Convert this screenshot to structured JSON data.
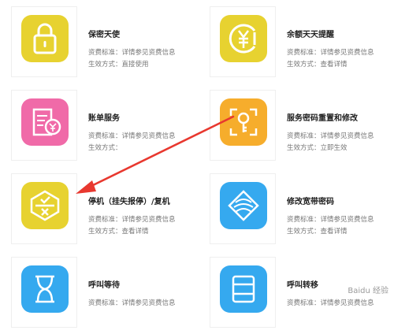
{
  "services": [
    {
      "title": "保密天使",
      "line1": "资费标准：详情参见资费信息",
      "line2": "生效方式：直接使用",
      "icon": "lock-icon",
      "color": "#e7d230"
    },
    {
      "title": "余额天天提醒",
      "line1": "资费标准：详情参见资费信息",
      "line2": "生效方式：查看详情",
      "icon": "yen-coin-icon",
      "color": "#e7d230"
    },
    {
      "title": "账单服务",
      "line1": "资费标准：详情参见资费信息",
      "line2": "生效方式：",
      "icon": "bill-icon",
      "color": "#f06aa8"
    },
    {
      "title": "服务密码重置和修改",
      "line1": "资费标准：详情参见资费信息",
      "line2": "生效方式：立即生效",
      "icon": "key-icon",
      "color": "#f6ad2c"
    },
    {
      "title": "停机（挂失报停）/复机",
      "line1": "资费标准：详情参见资费信息",
      "line2": "生效方式：查看详情",
      "icon": "suspend-icon",
      "color": "#e7d230"
    },
    {
      "title": "修改宽带密码",
      "line1": "资费标准：详情参见资费信息",
      "line2": "生效方式：查看详情",
      "icon": "network-icon",
      "color": "#35a9ef"
    },
    {
      "title": "呼叫等待",
      "line1": "资费标准：详情参见资费信息",
      "line2": "",
      "icon": "hourglass-icon",
      "color": "#35a9ef"
    },
    {
      "title": "呼叫转移",
      "line1": "资费标准：详情参见资费信息",
      "line2": "",
      "icon": "transfer-icon",
      "color": "#35a9ef"
    }
  ],
  "annotation": {
    "arrow_color": "#e8382f"
  },
  "watermark": "Baidu 经验"
}
